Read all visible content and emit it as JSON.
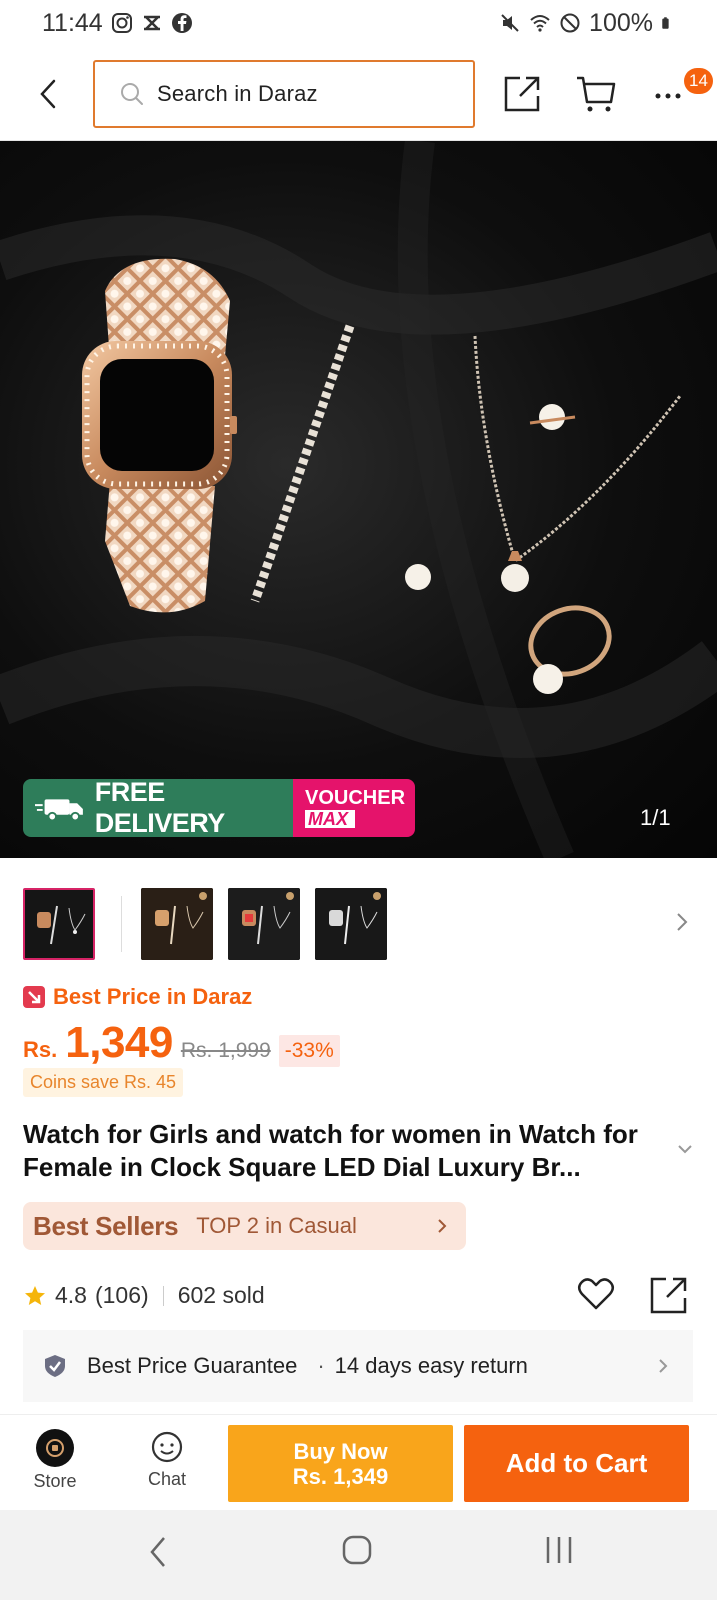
{
  "status_bar": {
    "time": "11:44",
    "battery": "100%"
  },
  "top_bar": {
    "search_placeholder": "Search in Daraz",
    "cart_badge": "14"
  },
  "hero": {
    "promo_free_tag": "FREE",
    "promo_free_label": "FREE DELIVERY",
    "promo_voucher_top": "VOUCHER",
    "promo_voucher_bottom": "MAX",
    "image_counter": "1/1"
  },
  "thumbnails": {
    "count": 4,
    "active_index": 0
  },
  "pricing": {
    "best_price_label": "Best Price in Daraz",
    "currency": "Rs.",
    "price": "1,349",
    "original_price": "Rs. 1,999",
    "discount": "-33%",
    "coins": "Coins save Rs. 45"
  },
  "product": {
    "title": "Watch for Girls and watch for women in Watch for Female in Clock Square LED Dial Luxury Br..."
  },
  "best_sellers": {
    "brand": "Best Sellers",
    "rank": "TOP 2 in Casual"
  },
  "rating": {
    "score": "4.8",
    "reviews": "(106)",
    "sold": "602 sold"
  },
  "guarantee": {
    "primary": "Best Price Guarantee",
    "separator": "·",
    "secondary": "14 days easy return"
  },
  "action_bar": {
    "store_label": "Store",
    "chat_label": "Chat",
    "buy_now_line1": "Buy Now",
    "buy_now_line2": "Rs. 1,349",
    "add_to_cart": "Add to Cart"
  },
  "colors": {
    "accent": "#f5620f",
    "buy_now": "#f9a51b",
    "free_delivery": "#2e7d5a",
    "voucher": "#e5136b"
  }
}
